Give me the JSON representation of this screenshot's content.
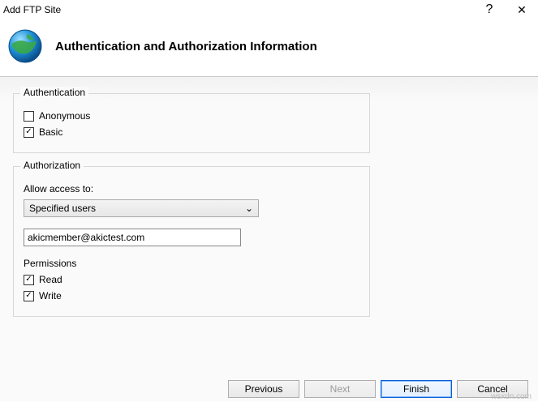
{
  "titlebar": {
    "title": "Add FTP Site",
    "help": "?",
    "close": "✕"
  },
  "header": {
    "heading": "Authentication and Authorization Information"
  },
  "authentication": {
    "legend": "Authentication",
    "anonymous_label": "Anonymous",
    "basic_label": "Basic",
    "anonymous_checked": "",
    "basic_checked": "✓"
  },
  "authorization": {
    "legend": "Authorization",
    "allow_label": "Allow access to:",
    "select_value": "Specified users",
    "chev": "⌄",
    "user_value": "akicmember@akictest.com",
    "permissions_label": "Permissions",
    "read_label": "Read",
    "write_label": "Write",
    "read_checked": "✓",
    "write_checked": "✓"
  },
  "buttons": {
    "previous": "Previous",
    "next": "Next",
    "finish": "Finish",
    "cancel": "Cancel"
  },
  "watermark": "wsxdn.com"
}
